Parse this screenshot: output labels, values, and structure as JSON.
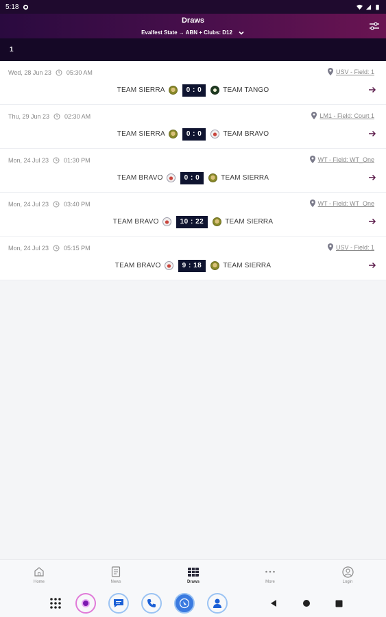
{
  "status": {
    "time": "5:18"
  },
  "header": {
    "title": "Draws",
    "subtitle": "Evalfest State → ABN + Clubs: D12"
  },
  "round": {
    "label": "1"
  },
  "matches": [
    {
      "date": "Wed, 28 Jun 23",
      "time": "05:30 AM",
      "venue": "USV - Field: 1",
      "home": "TEAM SIERRA",
      "home_logo": "sierra",
      "score": "0 : 0",
      "away": "TEAM TANGO",
      "away_logo": "tango"
    },
    {
      "date": "Thu, 29 Jun 23",
      "time": "02:30 AM",
      "venue": "LM1 - Field: Court 1",
      "home": "TEAM SIERRA",
      "home_logo": "sierra",
      "score": "0 : 0",
      "away": "TEAM BRAVO",
      "away_logo": "bravo"
    },
    {
      "date": "Mon, 24 Jul 23",
      "time": "01:30 PM",
      "venue": "WT - Field: WT_One",
      "home": "TEAM BRAVO",
      "home_logo": "bravo",
      "score": "0 : 0",
      "away": "TEAM SIERRA",
      "away_logo": "sierra"
    },
    {
      "date": "Mon, 24 Jul 23",
      "time": "03:40 PM",
      "venue": "WT - Field: WT_One",
      "home": "TEAM BRAVO",
      "home_logo": "bravo",
      "score": "10 : 22",
      "away": "TEAM SIERRA",
      "away_logo": "sierra"
    },
    {
      "date": "Mon, 24 Jul 23",
      "time": "05:15 PM",
      "venue": "USV - Field: 1",
      "home": "TEAM BRAVO",
      "home_logo": "bravo",
      "score": "9 : 18",
      "away": "TEAM SIERRA",
      "away_logo": "sierra"
    }
  ],
  "bottom_nav": [
    {
      "label": "Home",
      "icon": "home-icon",
      "active": false
    },
    {
      "label": "News",
      "icon": "news-icon",
      "active": false
    },
    {
      "label": "Draws",
      "icon": "draws-icon",
      "active": true
    },
    {
      "label": "More",
      "icon": "more-icon",
      "active": false
    },
    {
      "label": "Login",
      "icon": "login-icon",
      "active": false
    }
  ],
  "dock": [
    "apps-grid-icon",
    "camera-app-icon",
    "messages-app-icon",
    "phone-app-icon",
    "browser-app-icon",
    "contacts-app-icon"
  ],
  "colors": {
    "header_start": "#2a0a3f",
    "header_end": "#6a1452",
    "round_bar": "#150826",
    "score_bg": "#0f1430",
    "dock_ring": "#6f9de8"
  }
}
